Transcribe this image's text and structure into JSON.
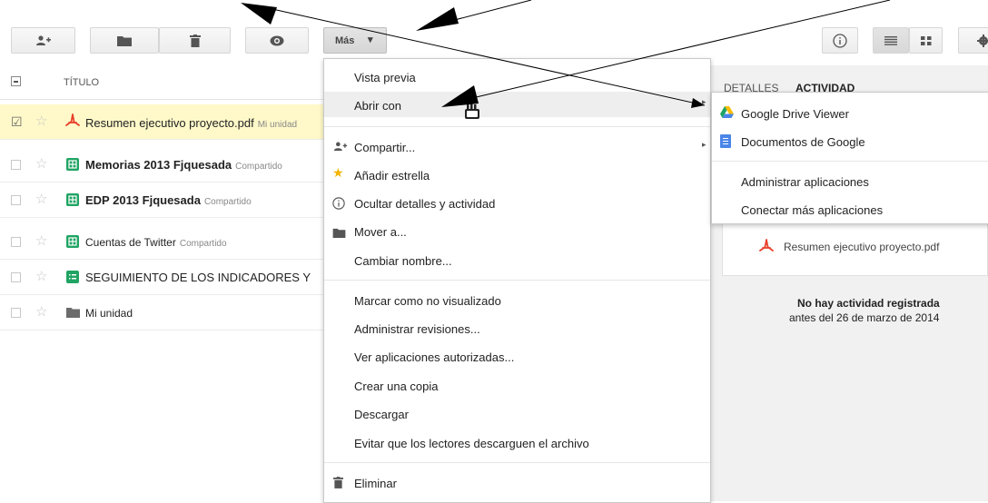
{
  "toolbar": {
    "more_label": "Más",
    "more_caret": "▾"
  },
  "list": {
    "header_title": "TÍTULO",
    "rows": [
      {
        "name": "Resumen ejecutivo proyecto.pdf",
        "tag": "Mi unidad",
        "type": "pdf",
        "bold": false,
        "selected": true
      },
      {
        "name": "Memorias 2013 Fjquesada",
        "tag": "Compartido",
        "type": "sheet",
        "bold": true,
        "selected": false
      },
      {
        "name": "EDP 2013 Fjquesada",
        "tag": "Compartido",
        "type": "sheet",
        "bold": true,
        "selected": false
      },
      {
        "name": "Cuentas de Twitter",
        "tag": "Compartido",
        "type": "sheet",
        "bold": false,
        "selected": false
      },
      {
        "name": "SEGUIMIENTO DE LOS INDICADORES Y",
        "tag": "",
        "type": "form",
        "bold": false,
        "selected": false
      },
      {
        "name": "Mi unidad",
        "tag": "",
        "type": "folder",
        "bold": false,
        "selected": false
      }
    ]
  },
  "details": {
    "tab_details": "DETALLES",
    "tab_activity": "ACTIVIDAD",
    "file_name": "Resumen ejecutivo proyecto.pdf",
    "no_activity": "No hay actividad registrada",
    "since": "antes del 26 de marzo de 2014"
  },
  "more_menu": {
    "items": {
      "preview": "Vista previa",
      "open_with": "Abrir con",
      "share": "Compartir...",
      "add_star": "Añadir estrella",
      "hide_details": "Ocultar detalles y actividad",
      "move_to": "Mover a...",
      "rename": "Cambiar nombre...",
      "mark_unviewed": "Marcar como no visualizado",
      "manage_revisions": "Administrar revisiones...",
      "authorized_apps": "Ver aplicaciones autorizadas...",
      "make_copy": "Crear una copia",
      "download": "Descargar",
      "prevent_download": "Evitar que los lectores descarguen el archivo",
      "delete": "Eliminar"
    }
  },
  "open_with_menu": {
    "drive_viewer": "Google Drive Viewer",
    "google_docs": "Documentos de Google",
    "manage_apps": "Administrar aplicaciones",
    "connect_apps": "Conectar más aplicaciones"
  },
  "colors": {
    "selected_row": "#fff9c9",
    "pdf_red": "#e8402b",
    "sheet_green": "#1fa463",
    "docs_blue": "#4a86e8",
    "folder_gray": "#6b6b6b"
  }
}
